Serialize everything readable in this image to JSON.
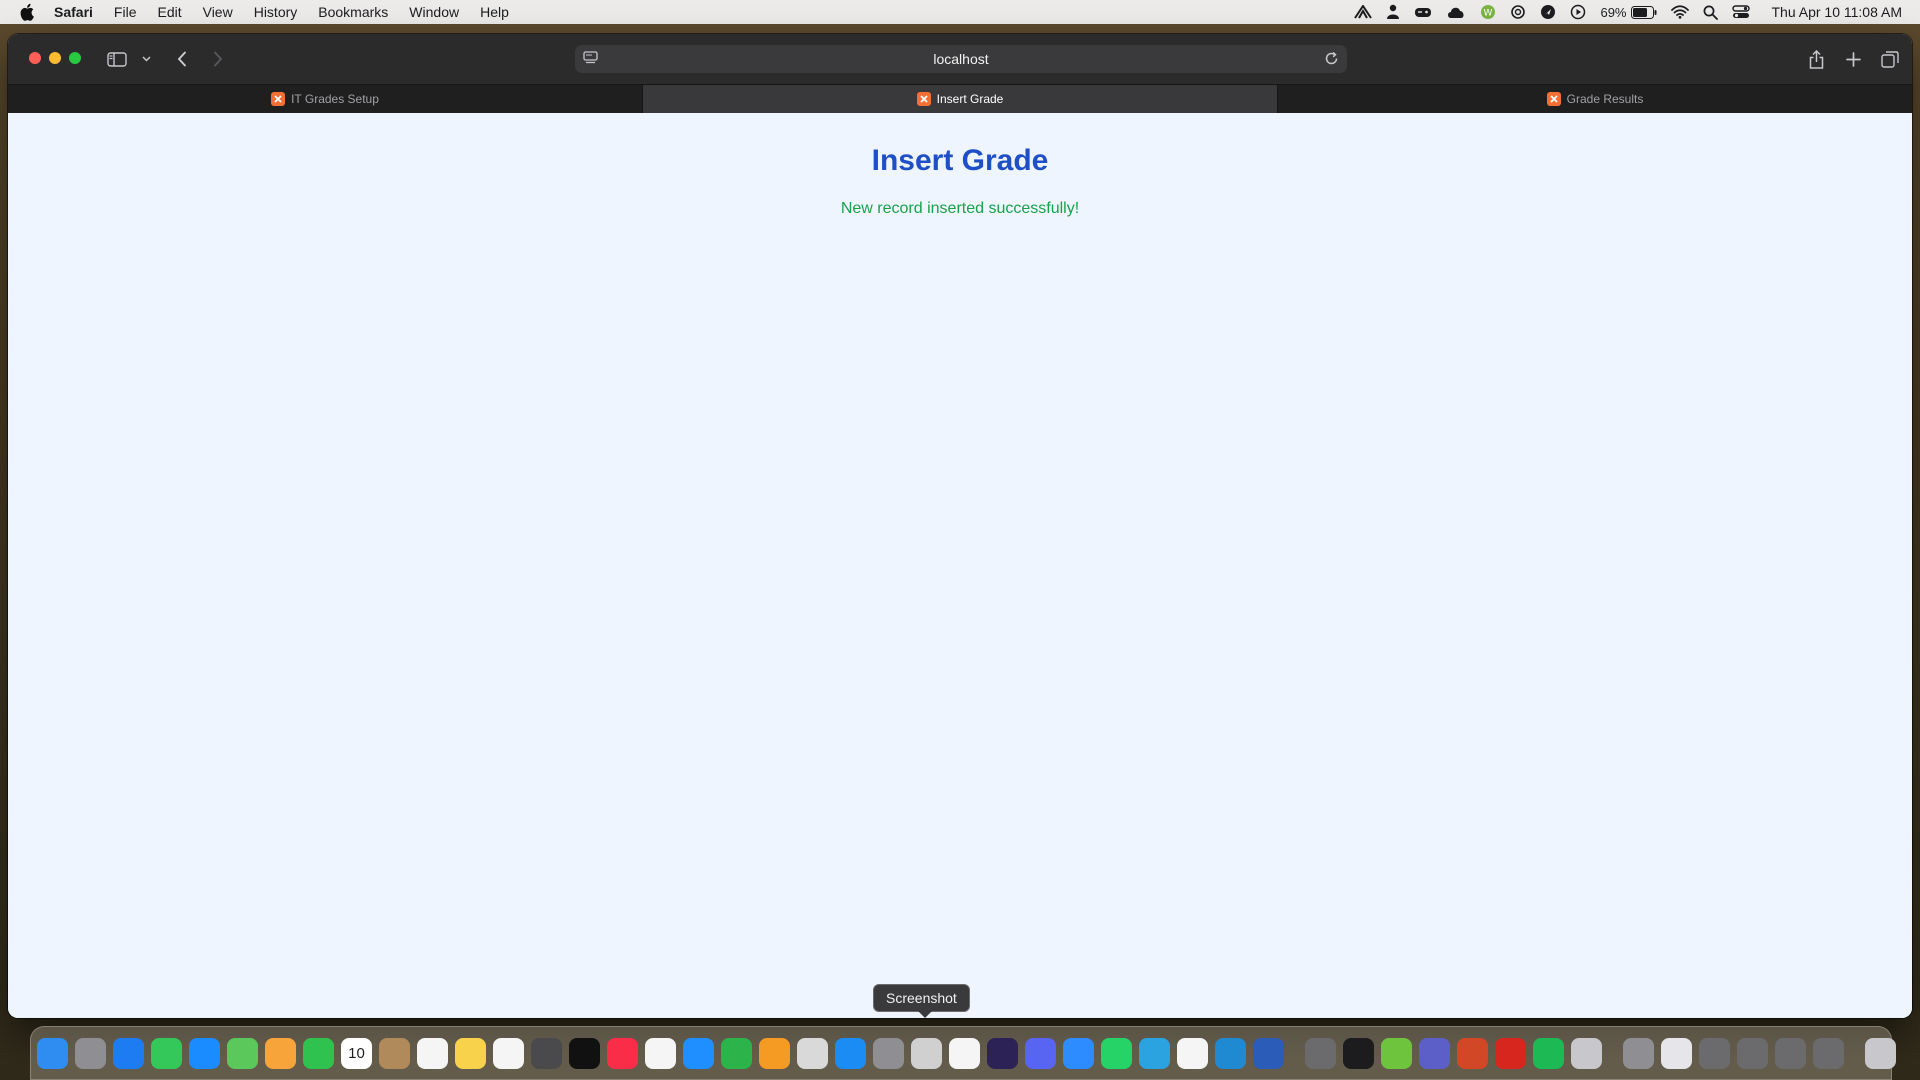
{
  "menubar": {
    "app_name": "Safari",
    "menus": [
      "File",
      "Edit",
      "View",
      "History",
      "Bookmarks",
      "Window",
      "Help"
    ],
    "battery_percent": "69%",
    "datetime": "Thu Apr 10  11:08 AM"
  },
  "browser": {
    "address": "localhost",
    "tabs": [
      {
        "label": "IT Grades Setup",
        "active": false
      },
      {
        "label": "Insert Grade",
        "active": true
      },
      {
        "label": "Grade Results",
        "active": false
      }
    ]
  },
  "page": {
    "title": "Insert Grade",
    "message": "New record inserted successfully!"
  },
  "colors": {
    "title": "#1f4fc7",
    "success": "#16a34a",
    "page_bg": "#eef5ff",
    "favicon": "#f46f34"
  },
  "tooltip": {
    "text": "Screenshot"
  },
  "dock": {
    "calendar_day": "10",
    "icons": [
      {
        "name": "finder-icon",
        "color": "#2f8cf0"
      },
      {
        "name": "launchpad-icon",
        "color": "#8e8e93"
      },
      {
        "name": "safari-icon",
        "color": "#1e7cf2"
      },
      {
        "name": "messages-icon",
        "color": "#34c759"
      },
      {
        "name": "mail-icon",
        "color": "#1a8cff"
      },
      {
        "name": "maps-icon",
        "color": "#5ac85a"
      },
      {
        "name": "photos-icon",
        "color": "#f7a43a"
      },
      {
        "name": "facetime-icon",
        "color": "#2fc24f"
      },
      {
        "name": "calendar-icon",
        "color": "#ffffff"
      },
      {
        "name": "contacts-icon",
        "color": "#b08a5a"
      },
      {
        "name": "reminders-icon",
        "color": "#f5f5f5"
      },
      {
        "name": "notes-icon",
        "color": "#f7d24a"
      },
      {
        "name": "freeform-icon",
        "color": "#f5f5f5"
      },
      {
        "name": "calculator-icon",
        "color": "#4a4a4c"
      },
      {
        "name": "tv-icon",
        "color": "#111111"
      },
      {
        "name": "music-icon",
        "color": "#fa2d48"
      },
      {
        "name": "news-icon",
        "color": "#f5f5f5"
      },
      {
        "name": "keynote-icon",
        "color": "#1f8fff"
      },
      {
        "name": "numbers-icon",
        "color": "#2cb34a"
      },
      {
        "name": "pages-icon",
        "color": "#f59a23"
      },
      {
        "name": "script-editor-icon",
        "color": "#d9d9d9"
      },
      {
        "name": "app-store-icon",
        "color": "#1c8cf5"
      },
      {
        "name": "system-settings-icon",
        "color": "#8e8e93"
      },
      {
        "name": "screenshot-icon",
        "color": "#d0d0d0"
      },
      {
        "name": "opera-icon",
        "color": "#f5f5f5"
      },
      {
        "name": "eclipse-icon",
        "color": "#2c2255"
      },
      {
        "name": "discord-icon",
        "color": "#5865f2"
      },
      {
        "name": "zoom-icon",
        "color": "#2d8cff"
      },
      {
        "name": "whatsapp-icon",
        "color": "#25d366"
      },
      {
        "name": "telegram-icon",
        "color": "#2aa3e0"
      },
      {
        "name": "chrome-icon",
        "color": "#f5f5f5"
      },
      {
        "name": "vscode-icon",
        "color": "#1f8ad2"
      },
      {
        "name": "word-icon",
        "color": "#2b5cb8"
      },
      {
        "name": "pen-tool-icon",
        "color": "#6b6b6e"
      },
      {
        "name": "terminal-icon",
        "color": "#1c1c1e"
      },
      {
        "name": "webstorm-icon",
        "color": "#6fc43e"
      },
      {
        "name": "teams-icon",
        "color": "#5b5fc7"
      },
      {
        "name": "powerpoint-icon",
        "color": "#d24726"
      },
      {
        "name": "acrobat-icon",
        "color": "#d7261e"
      },
      {
        "name": "spotify-icon",
        "color": "#1db954"
      },
      {
        "name": "utility-icon",
        "color": "#c7c7cc"
      },
      {
        "name": "folder-stack-icon",
        "color": "#8e8e93"
      },
      {
        "name": "downloads-stack-icon",
        "color": "#e5e5ea"
      },
      {
        "name": "documents-stack-icon",
        "color": "#6b6b6e"
      },
      {
        "name": "desktop-stack-icon",
        "color": "#6b6b6e"
      },
      {
        "name": "window-stack-icon",
        "color": "#6b6b6e"
      },
      {
        "name": "window-stack-2-icon",
        "color": "#6b6b6e"
      },
      {
        "name": "trash-icon",
        "color": "#c7c7cc"
      }
    ]
  }
}
